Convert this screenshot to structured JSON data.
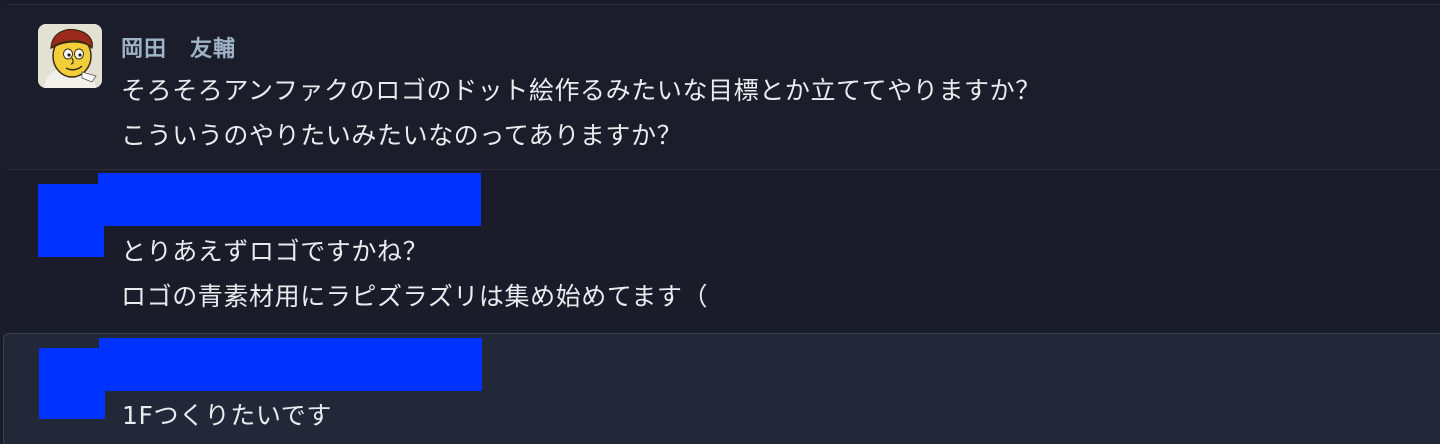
{
  "messages": [
    {
      "author": "岡田　友輔",
      "lines": [
        "そろそろアンファクのロゴのドット絵作るみたいな目標とか立ててやりますか？",
        "こういうのやりたいみたいなのってありますか？"
      ],
      "avatar_icon": "cartoon-avatar-icon"
    },
    {
      "author_redacted": true,
      "lines": [
        "とりあえずロゴですかね？",
        "ロゴの青素材用にラピズラズリは集め始めてます（"
      ]
    },
    {
      "author_redacted": true,
      "lines": [
        "1Fつくりたいです"
      ]
    }
  ],
  "colors": {
    "background": "#1a1d29",
    "hover_background": "#222837",
    "author": "#9fb3c6",
    "text": "#e9ecef",
    "redaction": "#0033ff"
  }
}
